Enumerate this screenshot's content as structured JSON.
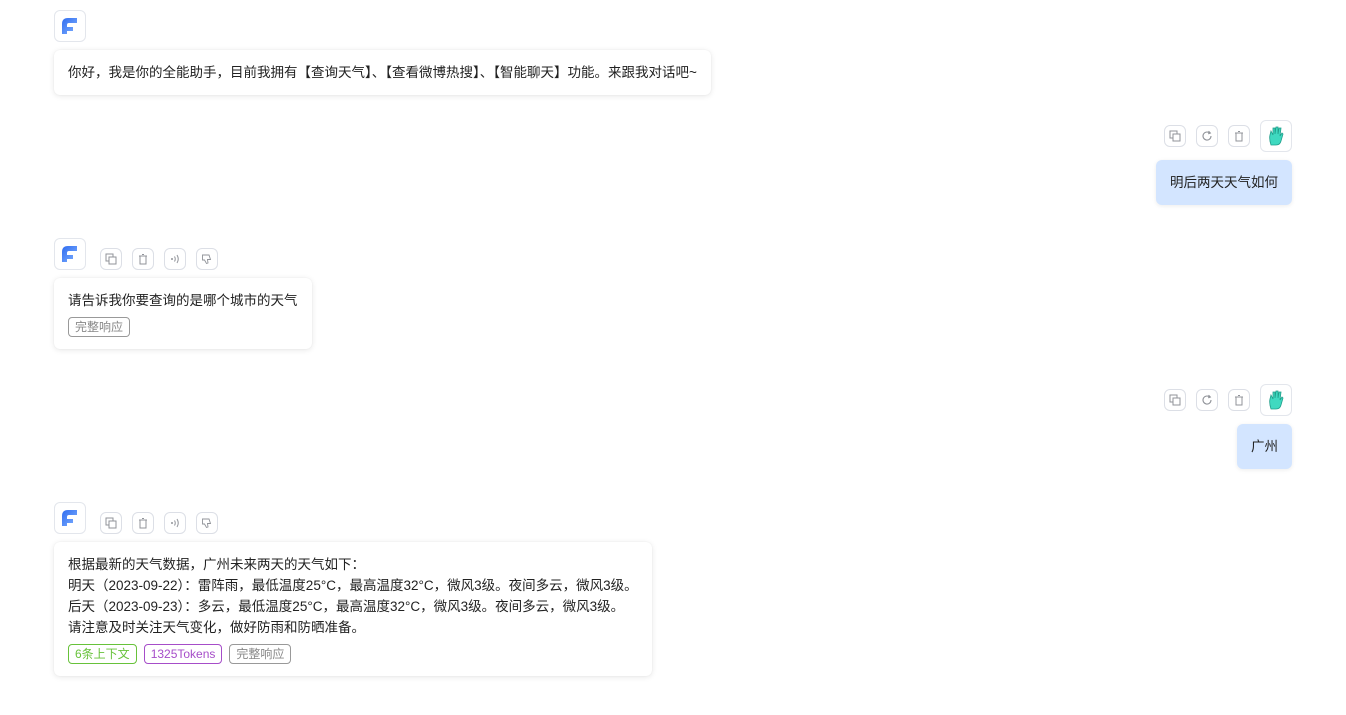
{
  "messages": [
    {
      "role": "ai",
      "lines": [
        "你好，我是你的全能助手，目前我拥有【查询天气】、【查看微博热搜】、【智能聊天】功能。来跟我对话吧~"
      ],
      "tags": []
    },
    {
      "role": "user",
      "text": "明后两天天气如何"
    },
    {
      "role": "ai",
      "lines": [
        "请告诉我你要查询的是哪个城市的天气"
      ],
      "tags": [
        "完整响应"
      ]
    },
    {
      "role": "user",
      "text": "广州"
    },
    {
      "role": "ai",
      "lines": [
        "根据最新的天气数据，广州未来两天的天气如下：",
        "明天（2023-09-22）：雷阵雨，最低温度25°C，最高温度32°C，微风3级。夜间多云，微风3级。",
        "后天（2023-09-23）：多云，最低温度25°C，最高温度32°C，微风3级。夜间多云，微风3级。",
        "请注意及时关注天气变化，做好防雨和防晒准备。"
      ],
      "tags": [
        "6条上下文",
        "1325Tokens",
        "完整响应"
      ]
    }
  ],
  "colors": {
    "tag_context": "#67c23a",
    "tag_tokens": "#a64dc9",
    "tag_complete": "#909399",
    "user_bubble": "#d3e5ff",
    "bot_logo": "#3a7bf6"
  },
  "icons": {
    "bot_avatar": "bot-logo-icon",
    "user_avatar": "green-hand-icon",
    "copy": "copy-icon",
    "regenerate": "refresh-icon",
    "delete": "trash-icon",
    "speak": "speaker-icon",
    "dislike": "thumbs-down-icon"
  }
}
